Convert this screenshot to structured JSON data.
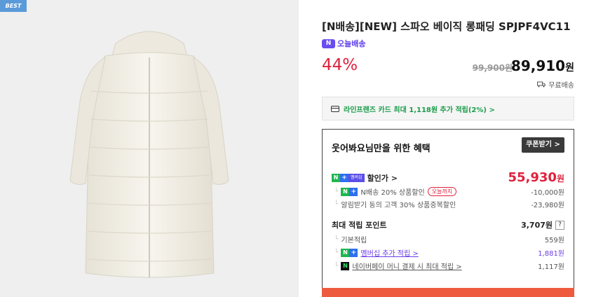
{
  "badge": "BEST",
  "product": {
    "title": "[N배송][NEW] 스파오 베이직 롱패딩 SPJPF4VC11",
    "delivery_badge": "N",
    "delivery_label": "오늘배송",
    "discount": "44%",
    "original_price": "99,900원",
    "sale_price": "89,910",
    "sale_currency": "원",
    "shipping": "무료배송"
  },
  "card_promo": "라인프렌즈 카드 최대 1,118원 추가 적립(2%) >",
  "benefit": {
    "title": "웃어봐요님만을 위한 혜택",
    "coupon_button": "쿠폰받기 >",
    "discount_label": "할인가 >",
    "membership_tag": "멤버십",
    "discount_price": "55,930",
    "discount_currency": "원",
    "items": [
      {
        "label": "N배송 20% 상품할인",
        "pill": "오늘까지",
        "value": "-10,000원"
      },
      {
        "label": "알림받기 동의 고객 30% 상품중복할인",
        "value": "-23,980원"
      }
    ],
    "points_label": "최대 적립 포인트",
    "points_value": "3,707원",
    "points_help": "?",
    "points_items": [
      {
        "label": "기본적립",
        "value": "559원"
      },
      {
        "label": "멤버십 추가 적립 >",
        "value": "1,881원"
      },
      {
        "label": "네이버페이 머니 결제 시 최대 적립 >",
        "value": "1,117원"
      }
    ]
  }
}
